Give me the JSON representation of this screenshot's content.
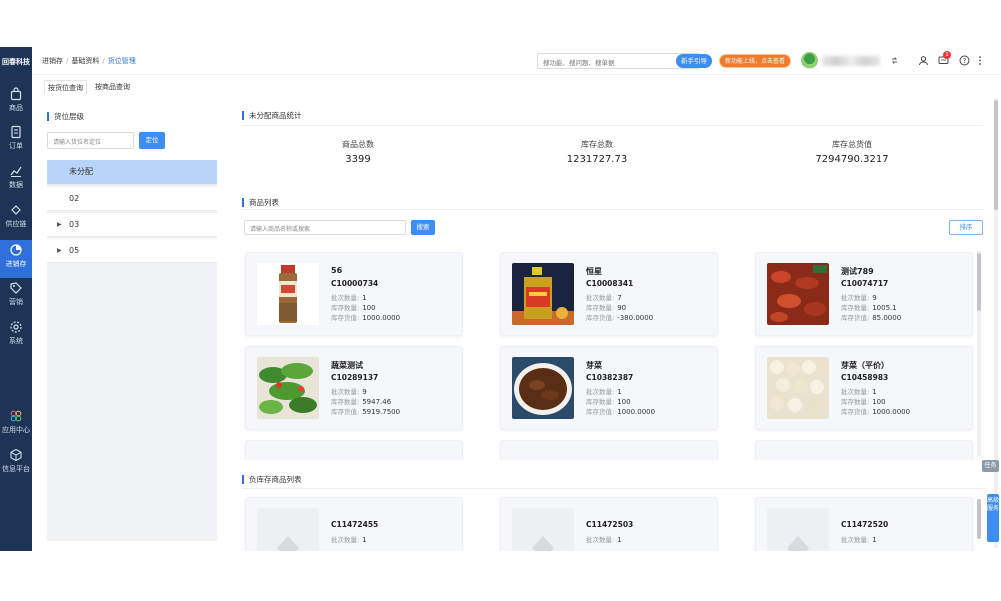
{
  "brand": {
    "logo_text": "回春科技"
  },
  "nav": {
    "items": [
      {
        "label": "商品",
        "icon": "bag-icon"
      },
      {
        "label": "订单",
        "icon": "order-icon"
      },
      {
        "label": "数据",
        "icon": "chart-icon"
      },
      {
        "label": "供应链",
        "icon": "supply-chain-icon"
      },
      {
        "label": "进销存",
        "icon": "inventory-icon",
        "active": true
      },
      {
        "label": "营销",
        "icon": "tag-icon"
      },
      {
        "label": "系统",
        "icon": "gear-icon"
      },
      {
        "label": "应用中心",
        "icon": "apps-icon"
      },
      {
        "label": "信息平台",
        "icon": "cube-icon"
      }
    ]
  },
  "header": {
    "breadcrumb": [
      "进销存",
      "基础资料",
      "货位管理"
    ],
    "search_placeholder": "搜功能、搜问题、搜单据",
    "guide_label": "新手引导",
    "promo_label": "新功能上线，点击查看",
    "notification_count": "1"
  },
  "tabs": [
    {
      "label": "按货位查询",
      "active": true
    },
    {
      "label": "按商品查询",
      "active": false
    }
  ],
  "location_panel": {
    "title": "货位层级",
    "input_placeholder": "请输入货位名定位",
    "locate_label": "定位",
    "tree": [
      {
        "label": "未分配",
        "selected": true,
        "expandable": false
      },
      {
        "label": "02",
        "selected": false,
        "expandable": false
      },
      {
        "label": "03",
        "selected": false,
        "expandable": true
      },
      {
        "label": "05",
        "selected": false,
        "expandable": true
      }
    ]
  },
  "stats": {
    "title": "未分配商品统计",
    "items": [
      {
        "label": "商品总数",
        "value": "3399"
      },
      {
        "label": "库存总数",
        "value": "1231727.73"
      },
      {
        "label": "库存总货值",
        "value": "7294790.3217"
      }
    ]
  },
  "product_list": {
    "title": "商品列表",
    "search_placeholder": "请输入商品名称或搜索",
    "search_label": "搜索",
    "sort_label": "排序",
    "field_labels": {
      "batch": "批次数量:",
      "stock": "库存数量:",
      "value": "库存货值:"
    },
    "products": [
      {
        "name": "56",
        "code": "C10000734",
        "batch": "1",
        "stock": "100",
        "value": "1000.0000",
        "image": "spice-bottle"
      },
      {
        "name": "恒星",
        "code": "C10008341",
        "batch": "7",
        "stock": "90",
        "value": "-380.0000",
        "image": "oil-jug"
      },
      {
        "name": "测试789",
        "code": "C10074717",
        "batch": "9",
        "stock": "1005.1",
        "value": "85.0000",
        "image": "crayfish"
      },
      {
        "name": "蔬菜测试",
        "code": "C10289137",
        "batch": "9",
        "stock": "5947.46",
        "value": "5919.7500",
        "image": "salad"
      },
      {
        "name": "芽菜",
        "code": "C10382387",
        "batch": "1",
        "stock": "100",
        "value": "1000.0000",
        "image": "pickles"
      },
      {
        "name": "芽菜（平价）",
        "code": "C10458983",
        "batch": "1",
        "stock": "100",
        "value": "1000.0000",
        "image": "garlic"
      }
    ]
  },
  "negative_list": {
    "title": "负库存商品列表",
    "products": [
      {
        "code": "C11472455",
        "batch": "1"
      },
      {
        "code": "C11472503",
        "batch": "1"
      },
      {
        "code": "C11472520",
        "batch": "1"
      }
    ]
  },
  "side_tabs": {
    "task_label": "任务",
    "service_label": "高级服务"
  }
}
